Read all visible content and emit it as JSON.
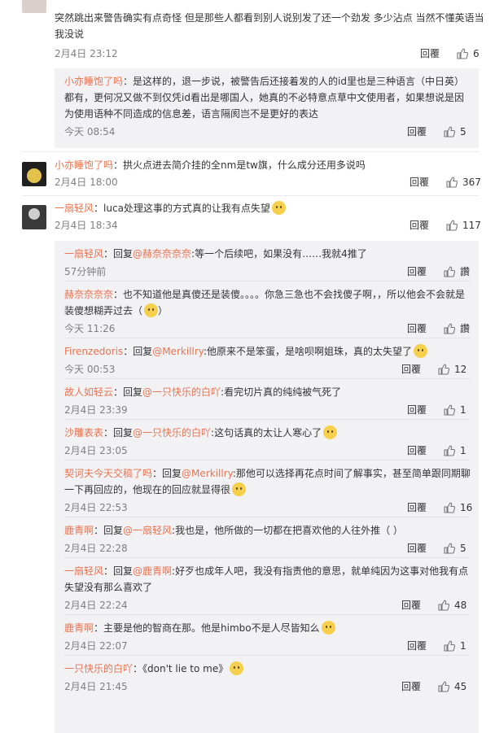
{
  "reply_label": "回覆",
  "c1": {
    "text": "突然跳出来警告确实有点奇怪 但是那些人都看到别人说别发了还一个劲发 多少沾点 当然不懂英语当我没说",
    "time": "2月4日 23:12",
    "likes": "6"
  },
  "c1_sub": {
    "user": "小亦睡饱了吗",
    "sep": "：",
    "text": "是这样的，退一步说，被警告后还接着发的人的id里也是三种语言（中日英）都有，更何况又做不到仅凭id看出是哪国人，她真的不必特意点草中文使用者，如果想说是因为使用语种不同造成的信息差，语言隔阂岂不是更好的表达",
    "time": "今天 08:54",
    "likes": "5"
  },
  "c2": {
    "user": "小亦睡饱了吗",
    "sep": "：",
    "text": "拱火点进去简介挂的全nm是tw旗，什么成分还用多说吗",
    "time": "2月4日 18:00",
    "likes": "367"
  },
  "c3": {
    "user": "一扇轻风",
    "sep": "：",
    "text": "luca处理这事的方式真的让我有点失望",
    "time": "2月4日 18:34",
    "likes": "117"
  },
  "subs": [
    {
      "user": "一扇轻风",
      "mid": "：回复",
      "target": "@赫奈奈奈奈",
      "text": ":等一个后续吧，如果没有……我就4推了",
      "time": "57分钟前",
      "likes": "讚"
    },
    {
      "user": "赫奈奈奈奈",
      "mid": "：",
      "target": "",
      "text": "也不知道他是真傻还是装傻。。。。你急三急也不会找傻子啊，，所以他会不会就是装傻想糊弄过去（",
      "text2": "）",
      "time": "今天 11:26",
      "likes": "讚"
    },
    {
      "user": "Firenzedoris",
      "mid": "：回复",
      "target": "@Merkillry",
      "text": ":他原来不是笨蛋，是啥呗啊姐珠，真的太失望了",
      "time": "今天 00:53",
      "likes": "12"
    },
    {
      "user": "故人如轻云",
      "mid": "：回复",
      "target": "@一只快乐的白吖",
      "text": ":看完切片真的纯纯被气死了",
      "time": "2月4日 23:39",
      "likes": "1"
    },
    {
      "user": "沙雕表表",
      "mid": "：回复",
      "target": "@一只快乐的白吖",
      "text": ":这句话真的太让人寒心了",
      "time": "2月4日 23:05",
      "likes": "1"
    },
    {
      "user": "契诃夫今天交稿了吗",
      "mid": "：回复",
      "target": "@Merkillry",
      "text": ":那他可以选择再花点时间了解事实，甚至简单跟同期聊一下再回应的，他现在的回应就显得很",
      "time": "2月4日 22:53",
      "likes": "16"
    },
    {
      "user": "鹿青啊",
      "mid": "：回复",
      "target": "@一扇轻风",
      "text": ":我也是，他所做的一切都在把喜欢他的人往外推（ ）",
      "time": "2月4日 22:28",
      "likes": "5"
    },
    {
      "user": "一扇轻风",
      "mid": "：回复",
      "target": "@鹿青啊",
      "text": ":好歹也成年人吧，我没有指责他的意思，就单纯因为这事对他我有点失望没有那么喜欢了",
      "time": "2月4日 22:24",
      "likes": "48"
    },
    {
      "user": "鹿青啊",
      "mid": "：",
      "target": "",
      "text": "主要是他的智商在那。他是himbo不是人尽皆知么",
      "time": "2月4日 22:07",
      "likes": "1"
    },
    {
      "user": "一只快乐的白吖",
      "mid": "：",
      "target": "",
      "text": "《don't lie to me》",
      "time": "2月4日 21:45",
      "likes": "45"
    }
  ],
  "colors": {
    "username": "#eb7350",
    "meta": "#808080",
    "subbg": "#f2f2f5"
  }
}
